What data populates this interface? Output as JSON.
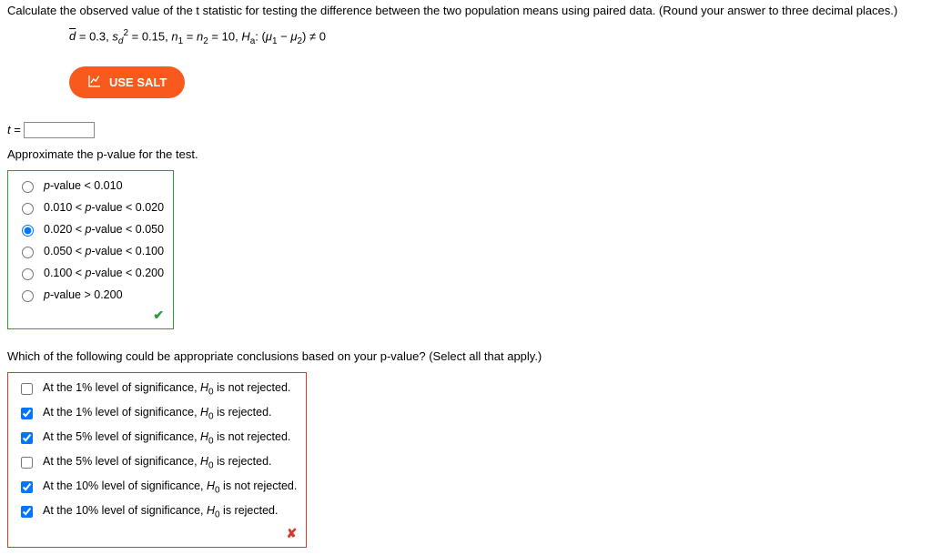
{
  "q_main": "Calculate the observed value of the t statistic for testing the difference between the two population means using paired data. (Round your answer to three decimal places.)",
  "given": {
    "dbar": "0.3",
    "sd2": "0.15",
    "n": "10",
    "ha_zero": "0"
  },
  "salt_label": "USE SALT",
  "t_label": "t",
  "t_value": "",
  "q_pvalue": "Approximate the p-value for the test.",
  "pvalue_options": [
    "p-value < 0.010",
    "0.010 < p-value < 0.020",
    "0.020 < p-value < 0.050",
    "0.050 < p-value < 0.100",
    "0.100 < p-value < 0.200",
    "p-value > 0.200"
  ],
  "pvalue_selected_index": 2,
  "q_conclusions": "Which of the following could be appropriate conclusions based on your p-value? (Select all that apply.)",
  "conclusion_options": [
    {
      "pre": "At the 1% level of significance, ",
      "h": "H",
      "sub": "0",
      "post": " is not rejected.",
      "checked": false
    },
    {
      "pre": "At the 1% level of significance, ",
      "h": "H",
      "sub": "0",
      "post": " is rejected.",
      "checked": true
    },
    {
      "pre": "At the 5% level of significance, ",
      "h": "H",
      "sub": "0",
      "post": " is not rejected.",
      "checked": true
    },
    {
      "pre": "At the 5% level of significance, ",
      "h": "H",
      "sub": "0",
      "post": " is rejected.",
      "checked": false
    },
    {
      "pre": "At the 10% level of significance, ",
      "h": "H",
      "sub": "0",
      "post": " is not rejected.",
      "checked": true
    },
    {
      "pre": "At the 10% level of significance, ",
      "h": "H",
      "sub": "0",
      "post": " is rejected.",
      "checked": true
    }
  ]
}
